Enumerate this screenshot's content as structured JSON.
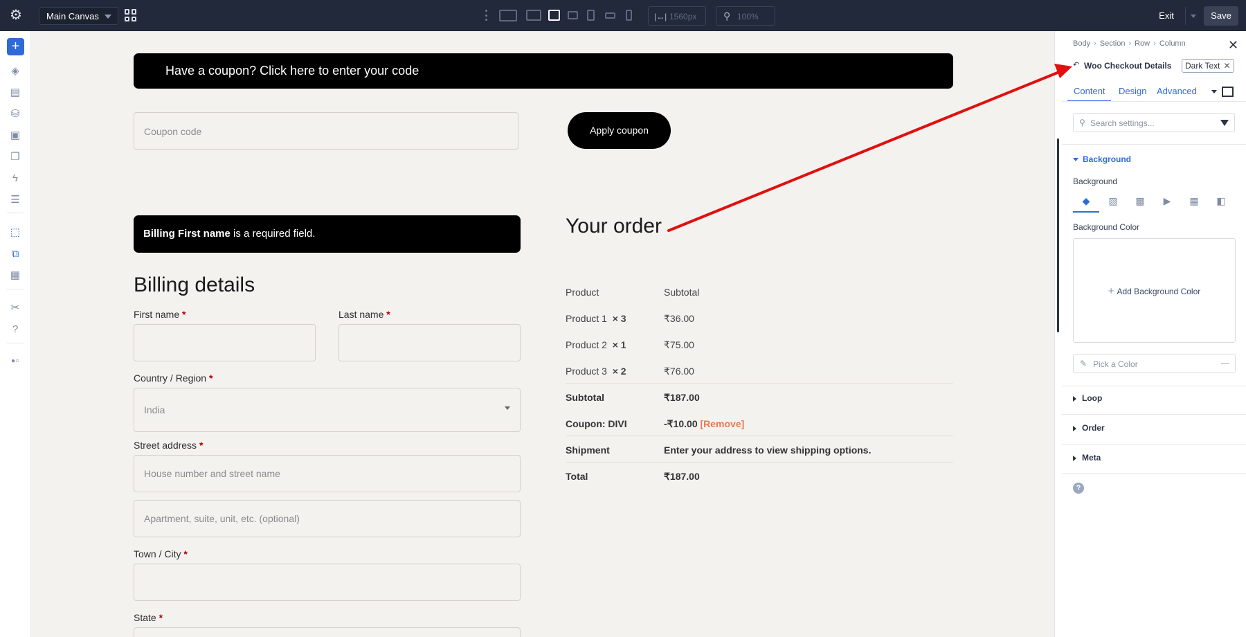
{
  "topbar": {
    "canvas_select": "Main Canvas",
    "width_value": "1560px",
    "zoom_value": "100%",
    "exit_label": "Exit",
    "save_label": "Save"
  },
  "main": {
    "coupon_banner": "Have a coupon? Click here to enter your code",
    "coupon_placeholder": "Coupon code",
    "apply_coupon": "Apply coupon",
    "error_bold": "Billing First name",
    "error_rest": " is a required field.",
    "billing_title": "Billing details",
    "fields": {
      "first_name": "First name",
      "last_name": "Last name",
      "country": "Country / Region",
      "country_value": "India",
      "street": "Street address",
      "street_placeholder": "House number and street name",
      "apartment_placeholder": "Apartment, suite, unit, etc. (optional)",
      "town": "Town / City",
      "state": "State",
      "required_mark": "*"
    },
    "order_title": "Your order",
    "order_table": {
      "header": [
        "Product",
        "Subtotal"
      ],
      "items": [
        {
          "name": "Product 1",
          "qty": "× 3",
          "subtotal": "₹36.00"
        },
        {
          "name": "Product 2",
          "qty": "× 1",
          "subtotal": "₹75.00"
        },
        {
          "name": "Product 3",
          "qty": "× 2",
          "subtotal": "₹76.00"
        }
      ],
      "subtotal_label": "Subtotal",
      "subtotal_value": "₹187.00",
      "coupon_label": "Coupon: DIVI",
      "coupon_value": "-₹10.00",
      "coupon_remove": "[Remove]",
      "shipment_label": "Shipment",
      "shipment_value": "Enter your address to view shipping options.",
      "total_label": "Total",
      "total_value": "₹187.00"
    }
  },
  "panel": {
    "breadcrumb": [
      "Body",
      "Section",
      "Row",
      "Column"
    ],
    "title": "Woo Checkout Details",
    "preset": "Dark Text",
    "tabs": [
      "Content",
      "Design",
      "Advanced"
    ],
    "search_placeholder": "Search settings...",
    "background_section": "Background",
    "background_label": "Background",
    "background_color_label": "Background Color",
    "add_background_color": "Add Background Color",
    "pick_color_placeholder": "Pick a Color",
    "sections": [
      "Loop",
      "Order",
      "Meta"
    ]
  },
  "colors": {
    "topbar": "#21293a",
    "accent": "#2f6bd8",
    "canvas_bg": "#f4f2ef",
    "arrow": "#e01010",
    "remove_link": "#e87a4f"
  }
}
